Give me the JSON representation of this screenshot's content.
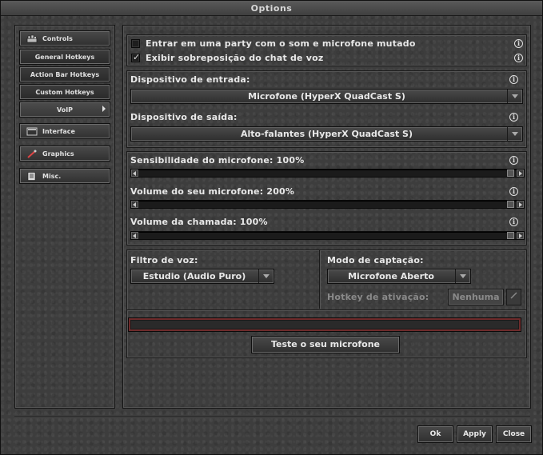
{
  "window": {
    "title": "Options"
  },
  "sidebar": {
    "items": [
      {
        "label": "Controls",
        "icon": "controls-icon"
      },
      {
        "label": "General Hotkeys"
      },
      {
        "label": "Action Bar Hotkeys"
      },
      {
        "label": "Custom Hotkeys"
      },
      {
        "label": "VoIP"
      },
      {
        "label": "Interface",
        "icon": "interface-icon"
      },
      {
        "label": "Graphics",
        "icon": "graphics-icon"
      },
      {
        "label": "Misc.",
        "icon": "misc-icon"
      }
    ]
  },
  "voip": {
    "mute_party": {
      "label": "Entrar em uma party com o som e microfone mutado",
      "checked": false
    },
    "voice_overlay": {
      "label": "Exibir sobreposição do chat de voz",
      "checked": true
    },
    "input_device": {
      "label": "Dispositivo de entrada:",
      "value": "Microfone (HyperX QuadCast S)"
    },
    "output_device": {
      "label": "Dispositivo de saída:",
      "value": "Alto-falantes (HyperX QuadCast S)"
    },
    "mic_sensitivity": {
      "label": "Sensibilidade do microfone: 100%",
      "fraction": 1.0
    },
    "mic_volume": {
      "label": "Volume do seu microfone: 200%",
      "fraction": 1.0
    },
    "call_volume": {
      "label": "Volume da chamada: 100%",
      "fraction": 1.0
    },
    "voice_filter": {
      "label": "Filtro de voz:",
      "value": "Estudio (Audio Puro)"
    },
    "capture_mode": {
      "label": "Modo de captação:",
      "value": "Microfone Aberto"
    },
    "activation_hotkey": {
      "label": "Hotkey de ativação:",
      "value": "Nenhuma"
    },
    "test_mic_label": "Teste o seu microfone",
    "info_glyph": "i"
  },
  "footer": {
    "ok_label": "Ok",
    "apply_label": "Apply",
    "close_label": "Close"
  },
  "colors": {
    "meter_border": "#6e2c2c",
    "background": "#3d3d3d"
  }
}
